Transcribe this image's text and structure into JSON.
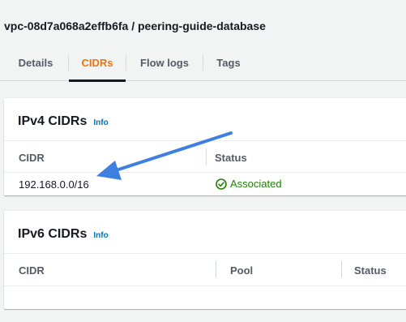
{
  "header": {
    "title": "vpc-08d7a068a2effb6fa / peering-guide-database"
  },
  "tabs": [
    {
      "label": "Details",
      "active": false
    },
    {
      "label": "CIDRs",
      "active": true
    },
    {
      "label": "Flow logs",
      "active": false
    },
    {
      "label": "Tags",
      "active": false
    }
  ],
  "ipv4": {
    "title": "IPv4 CIDRs",
    "info": "Info",
    "columns": [
      "CIDR",
      "Status"
    ],
    "rows": [
      {
        "cidr": "192.168.0.0/16",
        "status": "Associated",
        "status_icon": "check-circle-icon"
      }
    ]
  },
  "ipv6": {
    "title": "IPv6 CIDRs",
    "info": "Info",
    "columns": [
      "CIDR",
      "Pool",
      "Status"
    ],
    "rows": []
  },
  "annotation": {
    "icon": "arrow-icon",
    "color": "#3f7fe0"
  },
  "colors": {
    "active_tab": "#ec7211",
    "link": "#0073bb",
    "success": "#1d8102"
  }
}
